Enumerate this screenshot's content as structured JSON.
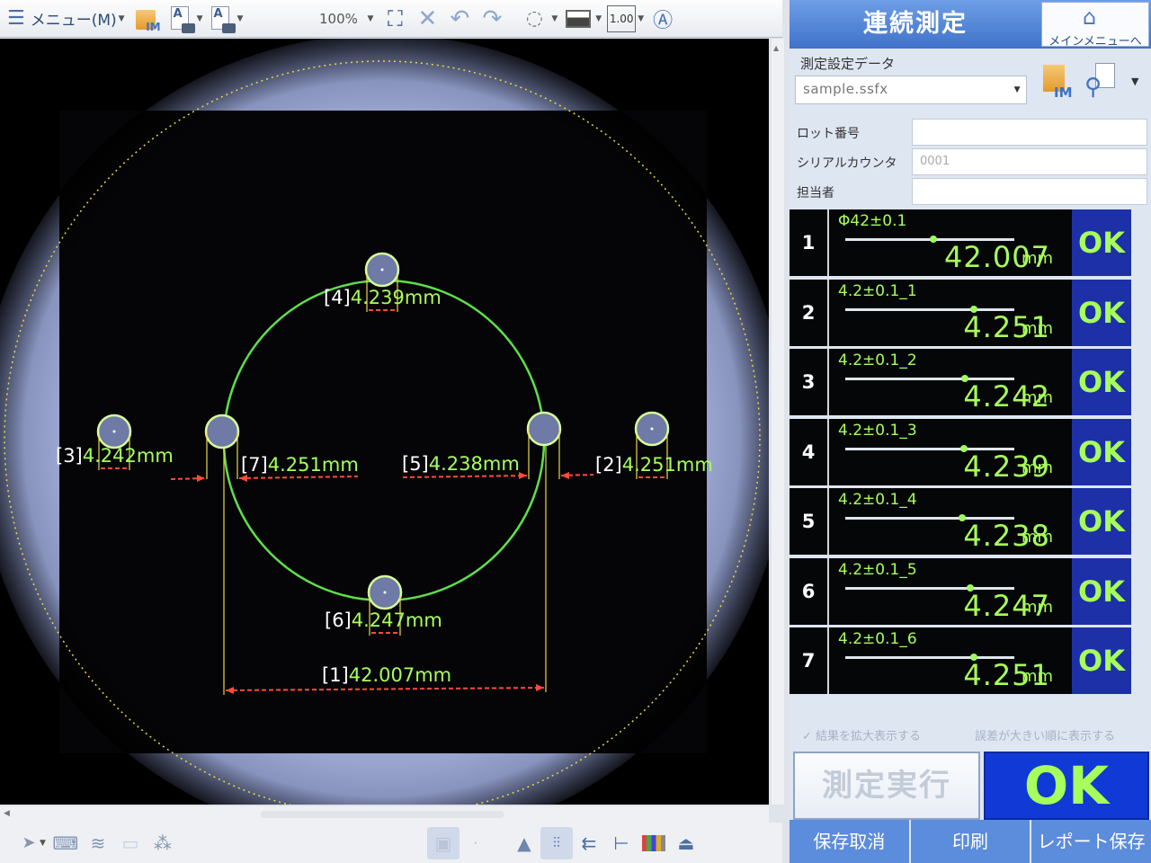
{
  "toolbar": {
    "menu_label": "メニュー(M)",
    "zoom": "100%",
    "scale_value": "1.00"
  },
  "panel": {
    "title": "連続測定",
    "main_menu": "メインメニューへ",
    "setting_label": "測定設定データ",
    "setting_file": "sample.ssfx",
    "info": [
      {
        "key": "ロット番号",
        "value": ""
      },
      {
        "key": "シリアルカウンタ",
        "value": "0001"
      },
      {
        "key": "担当者",
        "value": ""
      }
    ],
    "unit": "mm",
    "results": [
      {
        "no": "1",
        "name": "Φ42±0.1",
        "value": "42.007",
        "level": 0.52,
        "judge": "OK"
      },
      {
        "no": "2",
        "name": "4.2±0.1_1",
        "value": "4.251",
        "level": 0.76,
        "judge": "OK"
      },
      {
        "no": "3",
        "name": "4.2±0.1_2",
        "value": "4.242",
        "level": 0.71,
        "judge": "OK"
      },
      {
        "no": "4",
        "name": "4.2±0.1_3",
        "value": "4.239",
        "level": 0.7,
        "judge": "OK"
      },
      {
        "no": "5",
        "name": "4.2±0.1_4",
        "value": "4.238",
        "level": 0.69,
        "judge": "OK"
      },
      {
        "no": "6",
        "name": "4.2±0.1_5",
        "value": "4.247",
        "level": 0.74,
        "judge": "OK"
      },
      {
        "no": "7",
        "name": "4.2±0.1_6",
        "value": "4.251",
        "level": 0.76,
        "judge": "OK"
      }
    ],
    "opt_expand": "✓ 結果を拡大表示する",
    "opt_sort": "誤差が大きい順に表示する",
    "run_label": "測定実行",
    "total_judge": "OK",
    "footer": {
      "cancel": "保存取消",
      "print": "印刷",
      "report": "レポート保存"
    }
  },
  "measurements": [
    {
      "id": "[1]",
      "value": "42.007mm"
    },
    {
      "id": "[2]",
      "value": "4.251mm"
    },
    {
      "id": "[3]",
      "value": "4.242mm"
    },
    {
      "id": "[4]",
      "value": "4.239mm"
    },
    {
      "id": "[5]",
      "value": "4.238mm"
    },
    {
      "id": "[6]",
      "value": "4.247mm"
    },
    {
      "id": "[7]",
      "value": "4.251mm"
    }
  ],
  "colors": {
    "measure_green": "#a6ff5a",
    "circle_green": "#5ee04a",
    "dim_red": "#ff4a3a",
    "guide_yellow": "#e8d84a",
    "panel_blue": "#3f72c9",
    "judge_blue": "#1e30a8"
  }
}
